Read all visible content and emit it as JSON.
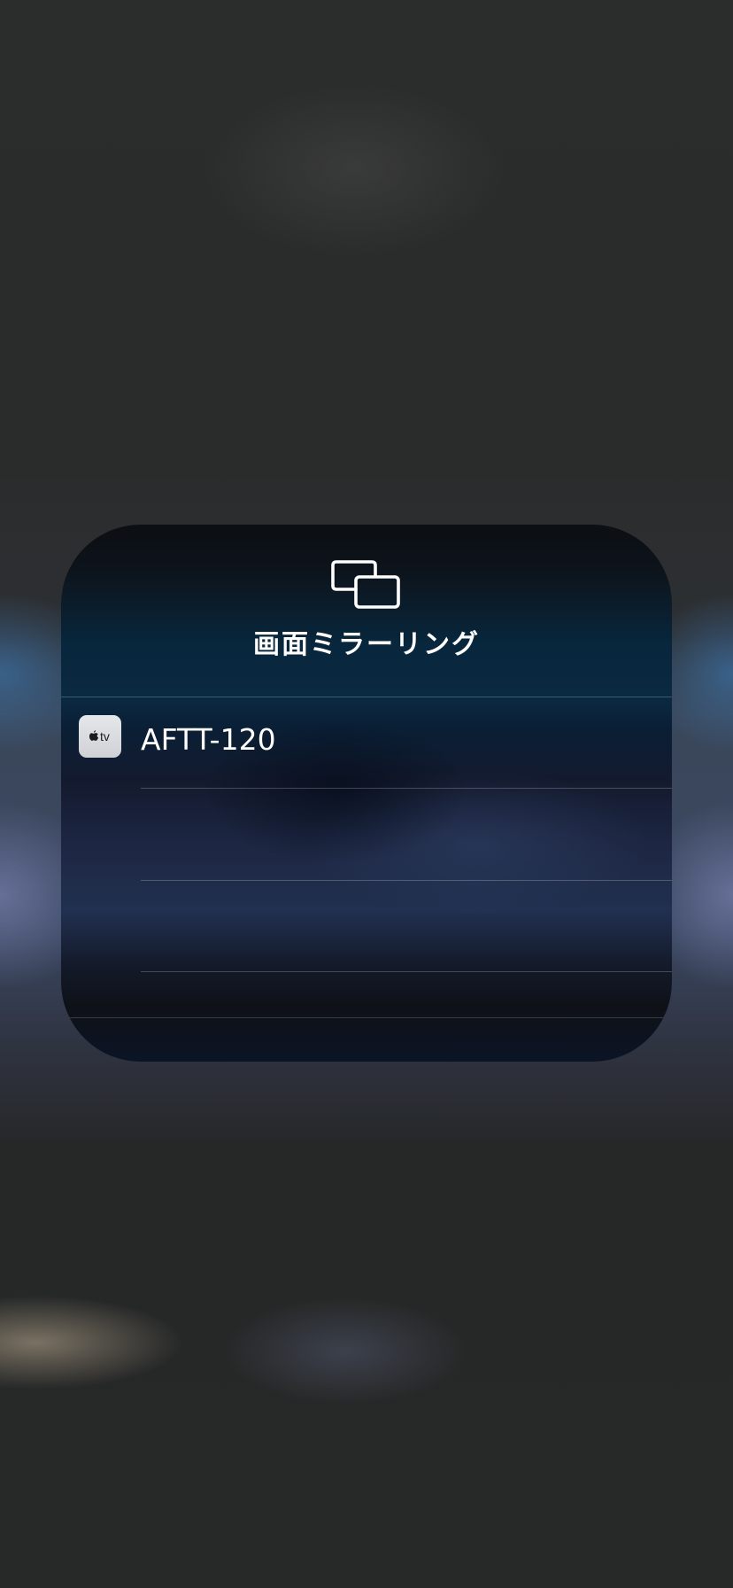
{
  "panel": {
    "icon": "screen-mirroring-icon",
    "title": "画面ミラーリング"
  },
  "devices": [
    {
      "icon": "appletv-icon",
      "icon_text": "tv",
      "label": "AFTT-120"
    }
  ],
  "colors": {
    "panel_top": "#0c0f13",
    "panel_accent": "#08263c",
    "text": "#ffffff",
    "separator": "rgba(255,255,255,0.22)"
  }
}
